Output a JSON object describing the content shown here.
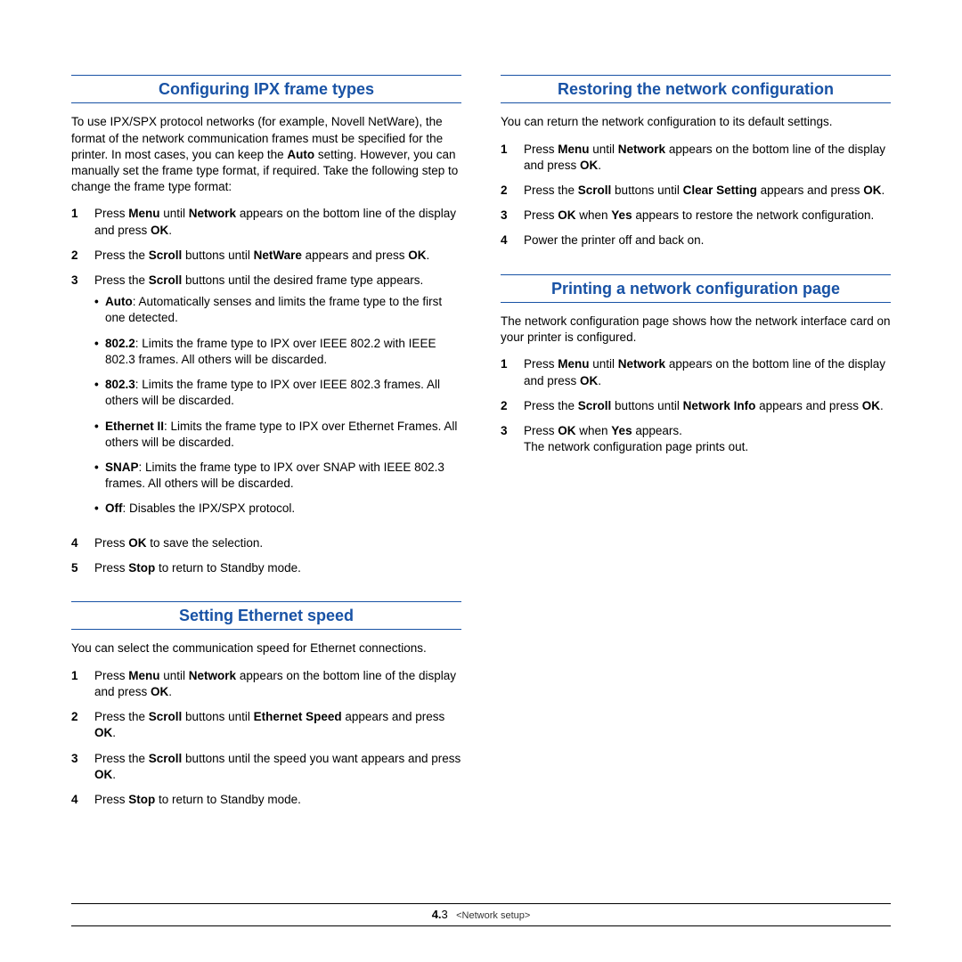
{
  "left": {
    "s1": {
      "title": "Configuring IPX frame types",
      "intro": "To use IPX/SPX protocol networks (for example, Novell NetWare), the format of the network communication frames must be specified for the printer. In most cases, you can keep the <b>Auto</b> setting. However, you can manually set the frame type format, if required. Take the following step to change the frame type format:",
      "steps": [
        "Press <b>Menu</b> until <b>Network</b> appears on the bottom line of the display and press <b>OK</b>.",
        "Press the <b>Scroll</b> buttons until <b>NetWare</b> appears and press <b>OK</b>.",
        "Press the <b>Scroll</b> buttons until the desired frame type appears.",
        "Press <b>OK</b> to save the selection.",
        "Press <b>Stop</b> to return to Standby mode."
      ],
      "bullets": [
        "<b>Auto</b>: Automatically senses and limits the frame type to the first one detected.",
        "<b>802.2</b>: Limits the frame type to IPX over IEEE 802.2 with IEEE 802.3 frames. All others will be discarded.",
        "<b>802.3</b>: Limits the frame type to IPX over IEEE 802.3 frames. All others will be discarded.",
        "<b>Ethernet II</b>: Limits the frame type to IPX over Ethernet Frames. All others will be discarded.",
        "<b>SNAP</b>: Limits the frame type to IPX over SNAP with IEEE 802.3 frames. All others will be discarded.",
        "<b>Off</b>: Disables the IPX/SPX protocol."
      ]
    },
    "s2": {
      "title": "Setting Ethernet speed",
      "intro": "You can select the communication speed for Ethernet connections.",
      "steps": [
        "Press <b>Menu</b> until <b>Network</b> appears on the bottom line of the display and press <b>OK</b>.",
        "Press the <b>Scroll</b> buttons until <b>Ethernet Speed</b> appears and press <b>OK</b>.",
        "Press the <b>Scroll</b> buttons until the speed you want appears and press <b>OK</b>.",
        "Press <b>Stop</b> to return to Standby mode."
      ]
    }
  },
  "right": {
    "s1": {
      "title": "Restoring the network configuration",
      "intro": "You can return the network configuration to its default settings.",
      "steps": [
        "Press <b>Menu</b> until <b>Network</b> appears on the bottom line of the display and press <b>OK</b>.",
        "Press the <b>Scroll</b> buttons until <b>Clear Setting</b> appears and press <b>OK</b>.",
        "Press <b>OK</b> when <b>Yes</b> appears to restore the network configuration.",
        "Power the printer off and back on."
      ]
    },
    "s2": {
      "title": "Printing a network configuration page",
      "intro": "The network configuration page shows how the network interface card on your printer is configured.",
      "steps": [
        "Press <b>Menu</b> until <b>Network</b> appears on the bottom line of the display and press <b>OK</b>.",
        "Press the <b>Scroll</b> buttons until <b>Network Info</b> appears and press <b>OK</b>.",
        "Press <b>OK</b> when <b>Yes</b> appears.<br>The network configuration page prints out."
      ]
    }
  },
  "footer": {
    "chapter": "4.",
    "page": "3",
    "section": "<Network setup>"
  }
}
